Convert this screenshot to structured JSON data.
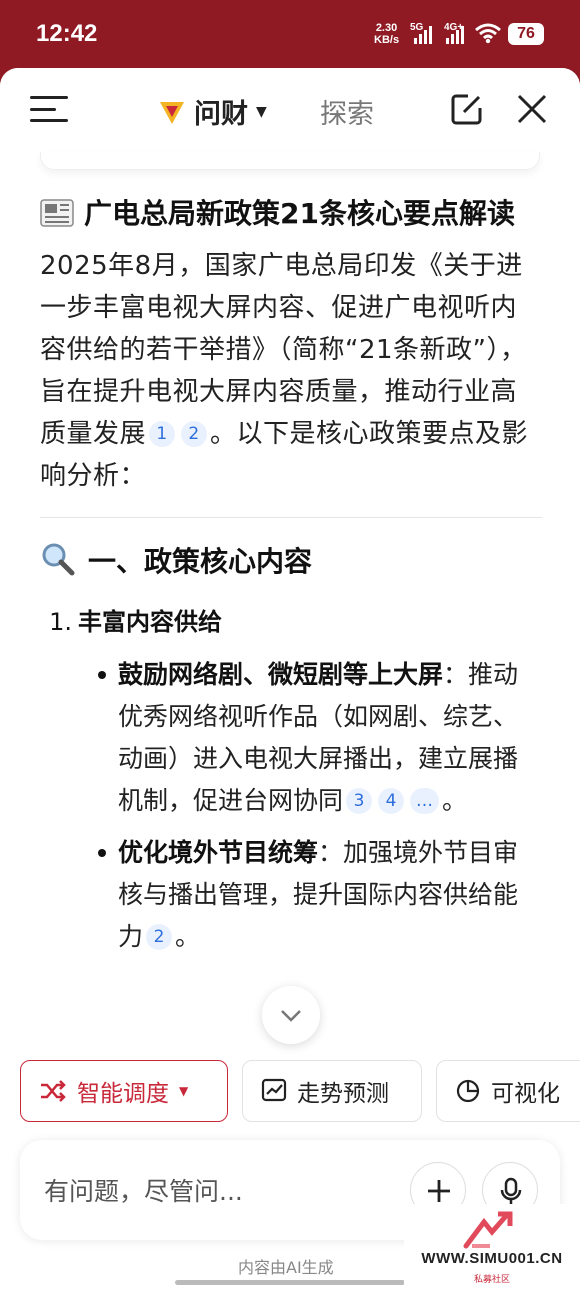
{
  "status_bar": {
    "time": "12:42",
    "speed_value": "2.30",
    "speed_unit": "KB/s",
    "sig1": "5G",
    "sig2": "4G+",
    "battery": "76"
  },
  "topbar": {
    "title": "问财",
    "explore": "探索"
  },
  "article": {
    "heading": "广电总局新政策21条核心要点解读",
    "intro_main": "2025年8月，国家广电总局印发《关于进一步丰富电视大屏内容、促进广电视听内容供给的若干举措》（简称“21条新政”），旨在提升电视大屏内容质量，推动行业高质量发展",
    "intro_cites": [
      "1",
      "2"
    ],
    "intro_tail": "。以下是核心政策要点及影响分析：",
    "section1_title": "一、政策核心内容",
    "item1_num": "1.",
    "item1_title": "丰富内容供给",
    "bullets": [
      {
        "bold": "鼓励网络剧、微短剧等上大屏",
        "text": "：推动优秀网络视听作品（如网剧、综艺、动画）进入电视大屏播出，建立展播机制，促进台网协同",
        "cites": [
          "3",
          "4",
          "…"
        ],
        "tail": "。"
      },
      {
        "bold": "优化境外节目统筹",
        "text": "：加强境外节目审核与播出管理，提升国际内容供给能力",
        "cites": [
          "2"
        ],
        "tail": "。"
      }
    ]
  },
  "chips": {
    "c1": "智能调度",
    "c2": "走势预测",
    "c3": "可视化"
  },
  "input": {
    "placeholder": "有问题，尽管问..."
  },
  "ai_note": "内容由AI生成",
  "watermark": {
    "url": "WWW.SIMU001.CN",
    "sub": "私募社区"
  },
  "colors": {
    "brand_red": "#8f1a24",
    "accent_red": "#c8283a",
    "cite_blue": "#2f6fdb"
  }
}
